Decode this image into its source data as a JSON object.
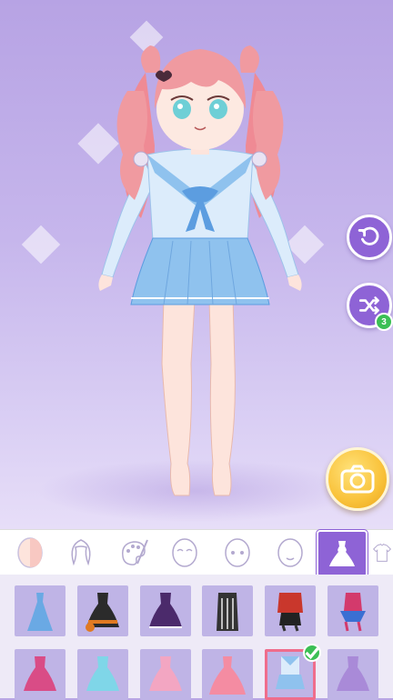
{
  "game": {
    "screen": "dress-up",
    "reroll_count": "3",
    "tabs": [
      "body",
      "hair",
      "color",
      "face",
      "eyes",
      "mouth",
      "outfit",
      "accessory"
    ],
    "active_tab": "outfit",
    "outfits": [
      {
        "name": "blue-gown",
        "color": "#6aa9e4"
      },
      {
        "name": "halloween-pumpkin-dress",
        "color": "#e07a22"
      },
      {
        "name": "dark-purple-lolita",
        "color": "#4b2a6b"
      },
      {
        "name": "black-striped-coat",
        "color": "#333333"
      },
      {
        "name": "red-jacket-outfit",
        "color": "#c9372c"
      },
      {
        "name": "jester-outfit",
        "color": "#d33a6c"
      },
      {
        "name": "pink-lace-dress",
        "color": "#d94c86"
      },
      {
        "name": "aqua-fairy-dress",
        "color": "#7fd6e8"
      },
      {
        "name": "pink-frill-dress",
        "color": "#f3a6c2"
      },
      {
        "name": "coral-ball-gown",
        "color": "#f48ca2"
      },
      {
        "name": "sailor-school-uniform",
        "color": "#8fc2ee"
      },
      {
        "name": "lavender-frill-dress",
        "color": "#a98ad8"
      }
    ],
    "selected_outfit": "sailor-school-uniform",
    "colors": {
      "accent": "#8e63d6",
      "camera": "#f9c23a",
      "check": "#3bbf55",
      "selection": "#ef6d8c"
    }
  }
}
